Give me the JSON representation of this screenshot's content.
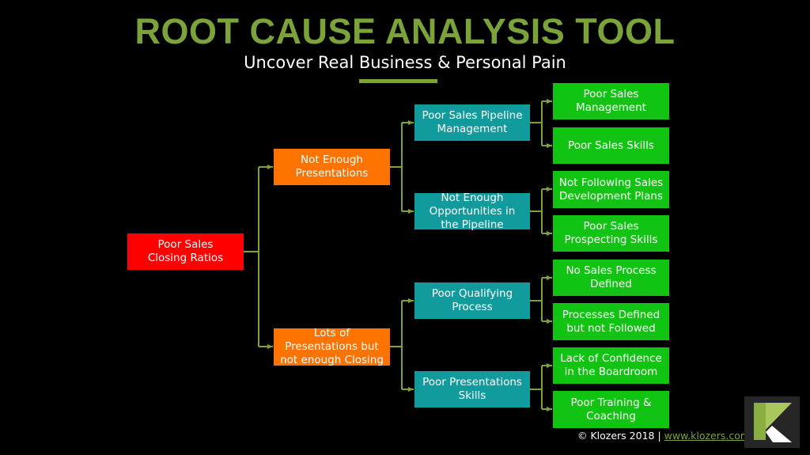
{
  "header": {
    "title": "ROOT CAUSE ANALYSIS TOOL",
    "subtitle": "Uncover Real Business & Personal Pain"
  },
  "colors": {
    "background": "#000000",
    "accent": "#7ba33a",
    "root": "#fe0000",
    "level1": "#ff7300",
    "level2": "#129b9c",
    "level3": "#12c412",
    "connector": "#7ba33a"
  },
  "tree": {
    "root": "Poor Sales Closing Ratios",
    "level1": [
      "Not Enough Presentations",
      "Lots of Presentations but not enough Closing"
    ],
    "level2": [
      "Poor Sales Pipeline Management",
      "Not Enough Opportunities in the Pipeline",
      "Poor Qualifying Process",
      "Poor Presentations Skills"
    ],
    "level3": [
      "Poor Sales Management",
      "Poor Sales Skills",
      "Not Following Sales Development Plans",
      "Poor Sales Prospecting Skills",
      "No Sales Process Defined",
      "Processes Defined but not Followed",
      "Lack of Confidence in the Boardroom",
      "Poor Training & Coaching"
    ]
  },
  "footer": {
    "copyright": "© Klozers 2018 | ",
    "link": "www.klozers.com"
  },
  "logo": {
    "icon": "klozers-k-logo"
  }
}
